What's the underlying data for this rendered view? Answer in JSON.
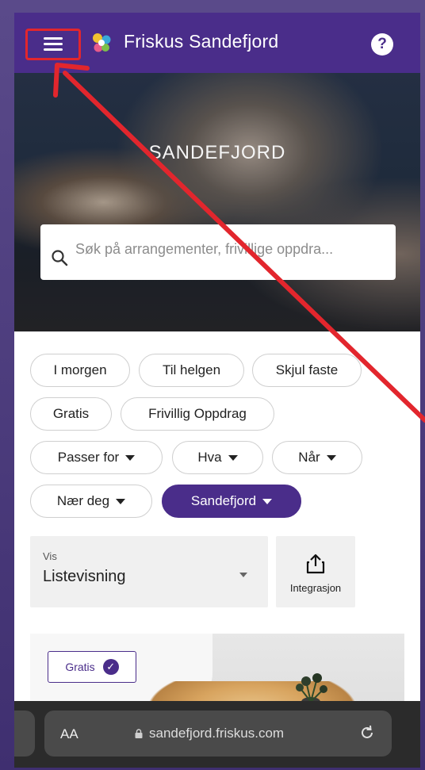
{
  "header": {
    "brand": "Friskus Sandefjord",
    "help_glyph": "?",
    "menu_icon": "hamburger-menu-icon",
    "logo_icon": "friskus-logo-icon"
  },
  "hero": {
    "title": "SANDEFJORD",
    "search_placeholder": "Søk på arrangementer, frivillige oppdra..."
  },
  "filters": {
    "chips": [
      {
        "label": "I morgen"
      },
      {
        "label": "Til helgen"
      },
      {
        "label": "Skjul faste"
      },
      {
        "label": "Gratis"
      },
      {
        "label": "Frivillig Oppdrag"
      },
      {
        "label": "Passer for"
      },
      {
        "label": "Hva"
      },
      {
        "label": "Når"
      },
      {
        "label": "Nær deg"
      },
      {
        "label": "Sandefjord"
      }
    ]
  },
  "view": {
    "label": "Vis",
    "value": "Listevisning"
  },
  "integration": {
    "label": "Integrasjon"
  },
  "card": {
    "badge": "Gratis",
    "badge_check": "✓"
  },
  "browser": {
    "aa": "AA",
    "url": "sandefjord.friskus.com"
  },
  "colors": {
    "brand_purple": "#4a2d8a",
    "annotation_red": "#e2262d"
  }
}
